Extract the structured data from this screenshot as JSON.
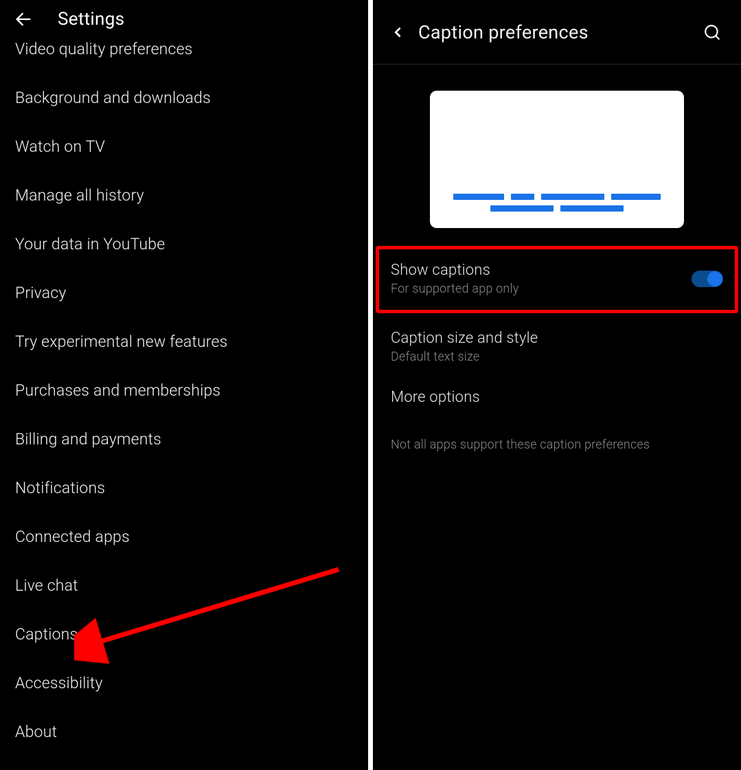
{
  "left": {
    "title": "Settings",
    "items": [
      "Video quality preferences",
      "Background and downloads",
      "Watch on TV",
      "Manage all history",
      "Your data in YouTube",
      "Privacy",
      "Try experimental new features",
      "Purchases and memberships",
      "Billing and payments",
      "Notifications",
      "Connected apps",
      "Live chat",
      "Captions",
      "Accessibility",
      "About"
    ]
  },
  "right": {
    "title": "Caption preferences",
    "show_captions": {
      "title": "Show captions",
      "sub": "For supported app only",
      "enabled": true
    },
    "size_style": {
      "title": "Caption size and style",
      "sub": "Default text size"
    },
    "more_options": {
      "title": "More options"
    },
    "note": "Not all apps support these caption preferences"
  },
  "annotations": {
    "arrow_target": "Captions",
    "highlight_target": "Show captions"
  }
}
